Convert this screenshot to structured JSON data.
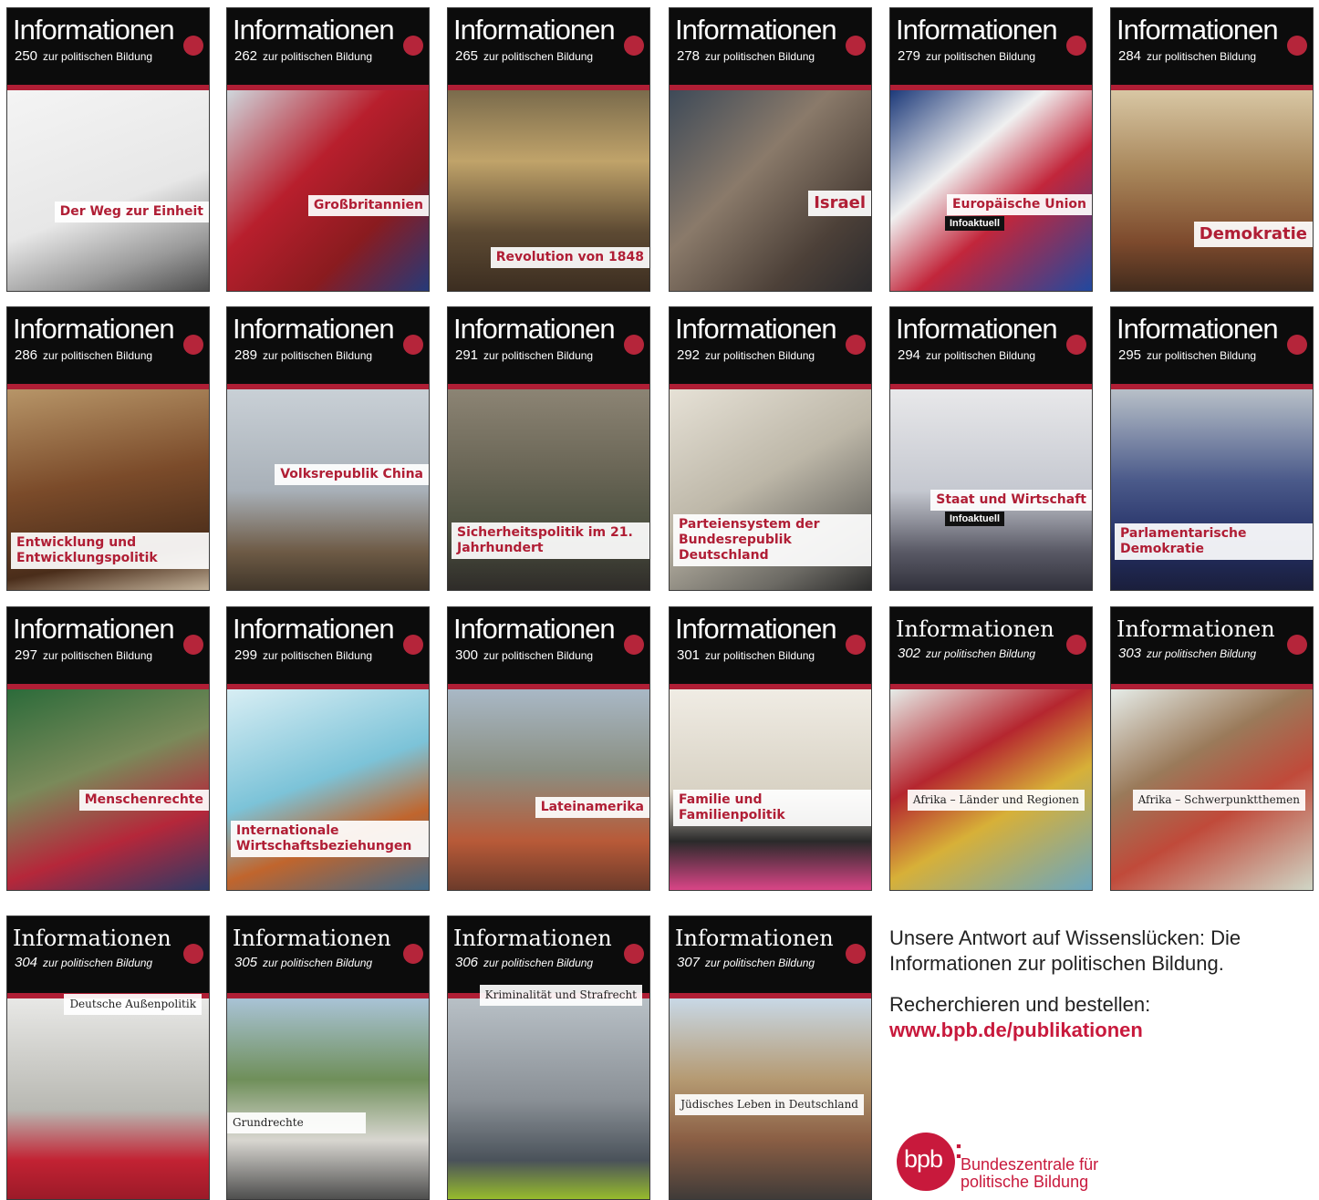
{
  "covers": [
    {
      "num": "250",
      "topic": "Der Weg zur Einheit"
    },
    {
      "num": "262",
      "topic": "Großbritannien"
    },
    {
      "num": "265",
      "topic": "Revolution von 1848"
    },
    {
      "num": "278",
      "topic": "Israel"
    },
    {
      "num": "279",
      "topic": "Europäische Union",
      "info": "Infoaktuell"
    },
    {
      "num": "284",
      "topic": "Demokratie"
    },
    {
      "num": "286",
      "topic": "Entwicklung und Entwicklungspolitik"
    },
    {
      "num": "289",
      "topic": "Volksrepublik China"
    },
    {
      "num": "291",
      "topic": "Sicherheitspolitik im 21. Jahrhundert"
    },
    {
      "num": "292",
      "topic": "Parteiensystem der Bundesrepublik Deutschland"
    },
    {
      "num": "294",
      "topic": "Staat und Wirtschaft",
      "info": "Infoaktuell"
    },
    {
      "num": "295",
      "topic": "Parlamentarische Demokratie"
    },
    {
      "num": "297",
      "topic": "Menschenrechte"
    },
    {
      "num": "299",
      "topic": "Internationale Wirtschaftsbeziehungen"
    },
    {
      "num": "300",
      "topic": "Lateinamerika"
    },
    {
      "num": "301",
      "topic": "Familie und Familienpolitik"
    },
    {
      "num": "302",
      "topic": "Afrika – Länder und Regionen"
    },
    {
      "num": "303",
      "topic": "Afrika – Schwerpunktthemen"
    },
    {
      "num": "304",
      "topic": "Deutsche Außenpolitik"
    },
    {
      "num": "305",
      "topic": "Grundrechte"
    },
    {
      "num": "306",
      "topic": "Kriminalität und Strafrecht"
    },
    {
      "num": "307",
      "topic": "Jüdisches Leben in Deutschland"
    }
  ],
  "masthead_title": "Informationen",
  "masthead_subtitle": "zur politischen Bildung",
  "promo": {
    "line1": "Unsere Antwort auf Wissenslücken: Die Informationen zur politischen Bildung.",
    "line2": "Recherchieren und bestellen:",
    "link": "www.bpb.de/publikationen"
  },
  "logo": {
    "mark": "bpb",
    "colon": ":",
    "name_line1": "Bundeszentrale für",
    "name_line2": "politische Bildung"
  },
  "colors": {
    "accent": "#c8193c",
    "masthead": "#0c0c0c"
  }
}
